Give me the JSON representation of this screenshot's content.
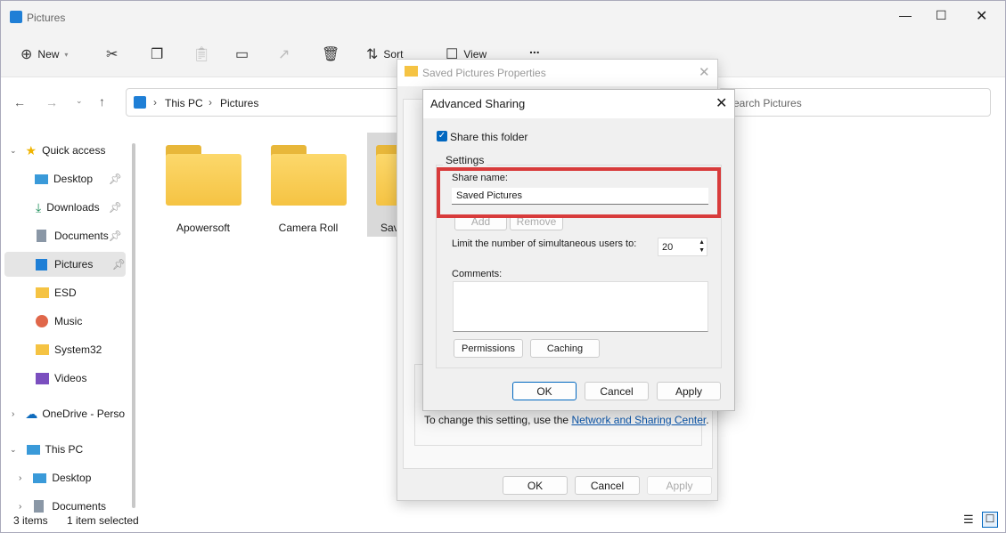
{
  "window": {
    "title": "Pictures"
  },
  "toolbar": {
    "new": "New",
    "sort": "Sort",
    "view": "View",
    "more": "..."
  },
  "address": {
    "parts": [
      "This PC",
      "Pictures"
    ],
    "search_placeholder": "Search Pictures"
  },
  "sidebar": {
    "items": [
      {
        "label": "Quick access",
        "icon": "star-icon"
      },
      {
        "label": "Desktop",
        "icon": "desktop-icon"
      },
      {
        "label": "Downloads",
        "icon": "download-icon"
      },
      {
        "label": "Documents",
        "icon": "document-icon"
      },
      {
        "label": "Pictures",
        "icon": "pictures-icon"
      },
      {
        "label": "ESD",
        "icon": "folder-icon"
      },
      {
        "label": "Music",
        "icon": "music-icon"
      },
      {
        "label": "System32",
        "icon": "folder-icon"
      },
      {
        "label": "Videos",
        "icon": "video-icon"
      },
      {
        "label": "OneDrive - Perso",
        "icon": "cloud-icon"
      },
      {
        "label": "This PC",
        "icon": "pc-icon"
      },
      {
        "label": "Desktop",
        "icon": "desktop-icon"
      },
      {
        "label": "Documents",
        "icon": "document-icon"
      }
    ]
  },
  "folders": [
    "Apowersoft",
    "Camera Roll",
    "Sav"
  ],
  "status": {
    "items": "3 items",
    "selected": "1 item selected"
  },
  "properties": {
    "title": "Saved Pictures Properties",
    "note": "To change this setting, use the ",
    "link": "Network and Sharing Center",
    "note_end": ".",
    "ok": "OK",
    "cancel": "Cancel",
    "apply": "Apply"
  },
  "advanced": {
    "title": "Advanced Sharing",
    "share_checkbox": "Share this folder",
    "share_checked": true,
    "settings": "Settings",
    "share_name_label": "Share name:",
    "share_name": "Saved Pictures",
    "add": "Add",
    "remove": "Remove",
    "limit_label": "Limit the number of simultaneous users to:",
    "limit_value": "20",
    "comments_label": "Comments:",
    "comments": "",
    "permissions": "Permissions",
    "caching": "Caching",
    "ok": "OK",
    "cancel": "Cancel",
    "apply": "Apply"
  },
  "colors": {
    "highlight": "#d83b3b",
    "accent": "#0067c0"
  }
}
